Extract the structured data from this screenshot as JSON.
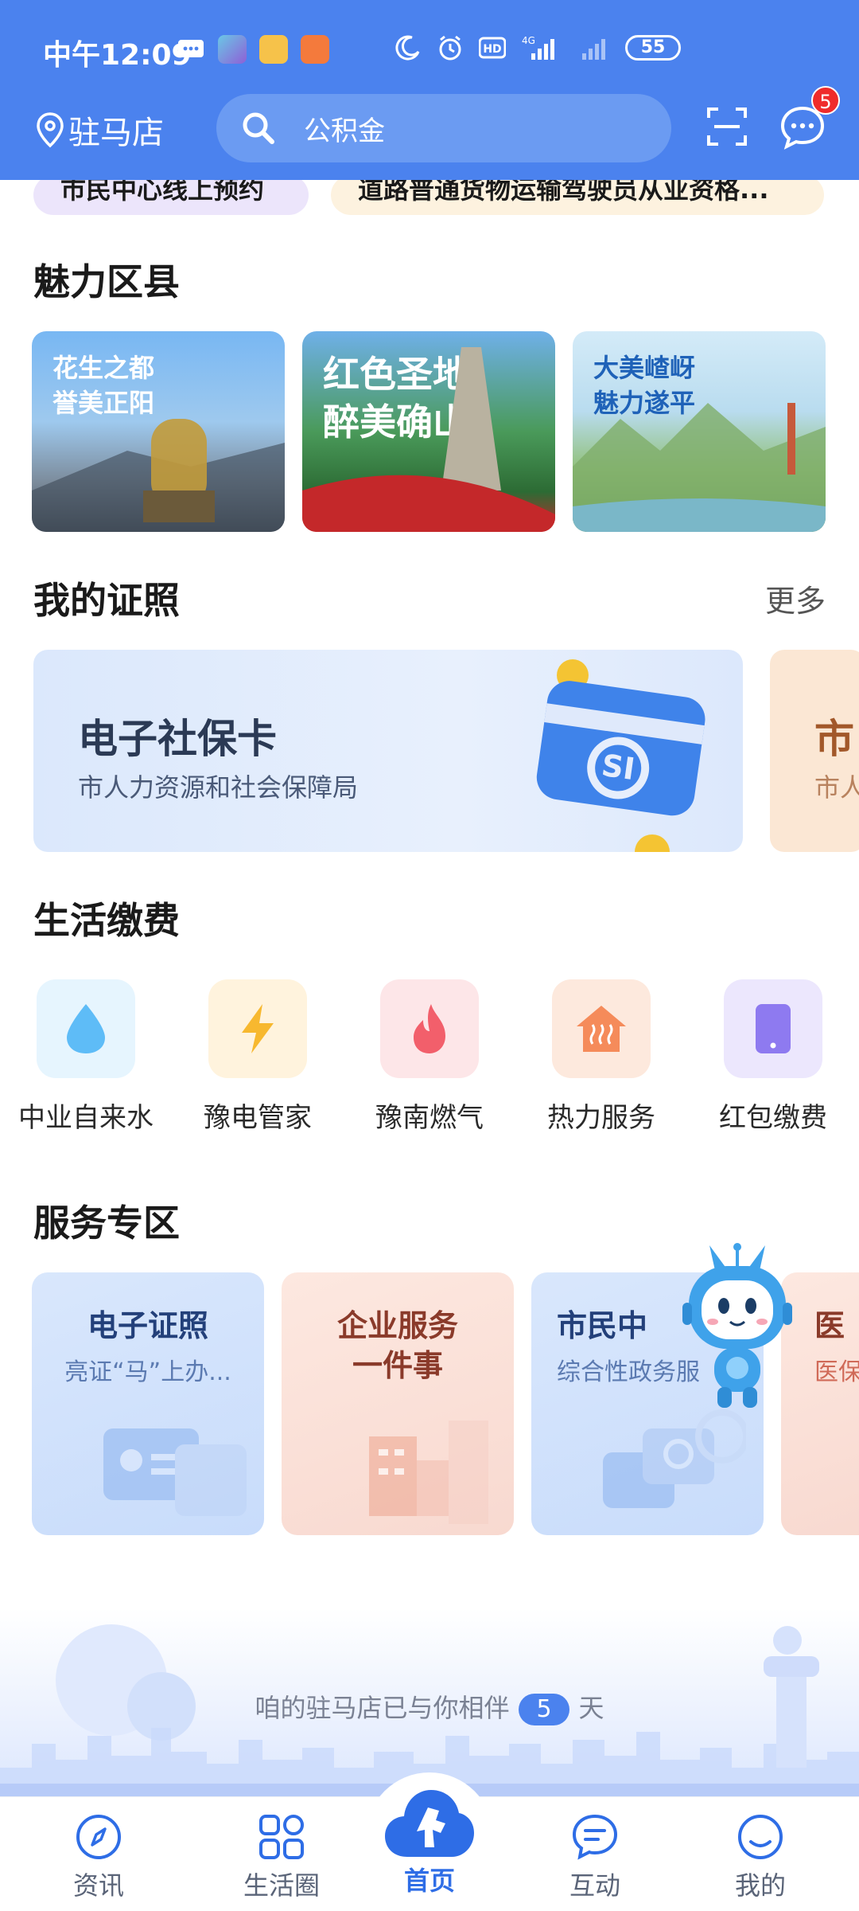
{
  "status_bar": {
    "time": "中午12:09",
    "battery": "55"
  },
  "header": {
    "location": "驻马店",
    "search_placeholder": "公积金",
    "message_badge": "5"
  },
  "tags": [
    "市民中心线上预约",
    "道路普通货物运输驾驶员从业资格..."
  ],
  "counties": {
    "title": "魅力区县",
    "items": [
      {
        "text": "花生之都\n誉美正阳"
      },
      {
        "text": "红色圣地\n醉美确山"
      },
      {
        "text": "大美嵖岈\n魅力遂平"
      }
    ]
  },
  "certificates": {
    "title": "我的证照",
    "more": "更多",
    "items": [
      {
        "title": "电子社保卡",
        "issuer": "市人力资源和社会保障局"
      },
      {
        "title": "市",
        "issuer": "市人"
      }
    ]
  },
  "payments": {
    "title": "生活缴费",
    "items": [
      {
        "label": "中业自来水",
        "icon": "water-drop-icon",
        "color": "#5ebcf7",
        "bg": "#e6f5fe"
      },
      {
        "label": "豫电管家",
        "icon": "lightning-icon",
        "color": "#f7b82f",
        "bg": "#fff3dd"
      },
      {
        "label": "豫南燃气",
        "icon": "flame-icon",
        "color": "#f25f6b",
        "bg": "#fde6e8"
      },
      {
        "label": "热力服务",
        "icon": "heating-house-icon",
        "color": "#f58b5a",
        "bg": "#fde9dd"
      },
      {
        "label": "红包缴费",
        "icon": "phone-icon",
        "color": "#8e7af0",
        "bg": "#ece7fd"
      }
    ]
  },
  "services": {
    "title": "服务专区",
    "items": [
      {
        "title": "电子证照",
        "subtitle": "亮证“马”上办..."
      },
      {
        "title": "企业服务\n一件事",
        "subtitle": ""
      },
      {
        "title": "市民中",
        "subtitle": "综合性政务服"
      },
      {
        "title": "医",
        "subtitle": "医保"
      }
    ]
  },
  "banner": {
    "text_before": "咱的驻马店已与你相伴",
    "days": "5",
    "text_after": "天"
  },
  "bottom_nav": [
    {
      "label": "资讯",
      "icon": "compass-icon"
    },
    {
      "label": "生活圈",
      "icon": "grid-icon"
    },
    {
      "label": "首页",
      "icon": "home-horse-icon"
    },
    {
      "label": "互动",
      "icon": "chat-icon"
    },
    {
      "label": "我的",
      "icon": "profile-icon"
    }
  ],
  "colors": {
    "brand_blue": "#4b82ee",
    "accent_blue": "#2e6de6",
    "badge_red": "#ef2b2b"
  }
}
